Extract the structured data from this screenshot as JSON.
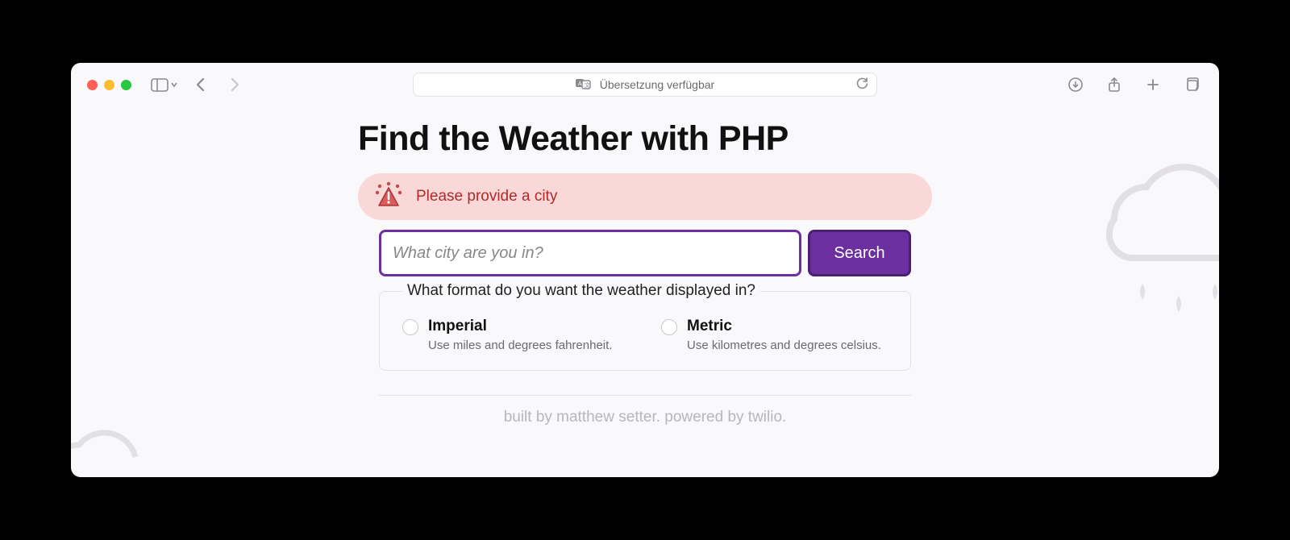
{
  "toolbar": {
    "address_text": "Übersetzung verfügbar"
  },
  "page": {
    "title": "Find the Weather with PHP",
    "alert_message": "Please provide a city",
    "search": {
      "placeholder": "What city are you in?",
      "button_label": "Search"
    },
    "format": {
      "legend": "What format do you want the weather displayed in?",
      "options": [
        {
          "label": "Imperial",
          "description": "Use miles and degrees fahrenheit."
        },
        {
          "label": "Metric",
          "description": "Use kilometres and degrees celsius."
        }
      ]
    },
    "footer": "built by matthew setter. powered by twilio."
  }
}
